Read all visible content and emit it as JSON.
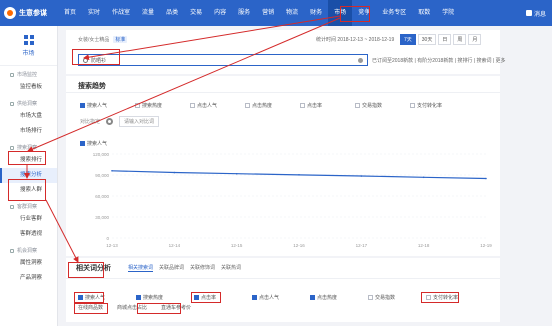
{
  "app": {
    "logo_text": "生意参谋"
  },
  "topnav": {
    "items": [
      "首页",
      "实时",
      "作战室",
      "流量",
      "品类",
      "交易",
      "内容",
      "服务",
      "营销",
      "物流",
      "财务",
      "市场",
      "竞争",
      "业务专区",
      "取数",
      "学院"
    ],
    "active_index": 11,
    "user": "消息"
  },
  "sidebar": {
    "title": "市场",
    "groups": [
      {
        "label": "市场监控",
        "items": [
          "监控看板"
        ]
      },
      {
        "label": "供给洞察",
        "items": [
          "市场大盘",
          "市场排行"
        ]
      },
      {
        "label": "搜索洞察",
        "items": [
          "搜索排行",
          "搜索分析",
          "搜索人群"
        ]
      },
      {
        "label": "客群洞察",
        "items": [
          "行业客群",
          "客群透视"
        ]
      },
      {
        "label": "机会洞察",
        "items": [
          "属性洞察",
          "产品洞察"
        ]
      }
    ],
    "selected": "搜索分析"
  },
  "header": {
    "breadcrumb_1": "女装/女士精品",
    "breadcrumb_tag": "标准",
    "date_range": "统计时间 2018-12-13 ~ 2018-12-19",
    "period_buttons": [
      "7天",
      "30天",
      "日",
      "周",
      "月"
    ],
    "search_value": "防晒衫",
    "links": "已订阅至2018新款 | 有阶分2018新款 | 搜排行 | 搜索词 | 更多"
  },
  "trend": {
    "title": "搜索趋势",
    "metrics": [
      {
        "label": "搜索人气",
        "checked": true
      },
      {
        "label": "搜索热度",
        "checked": false
      },
      {
        "label": "点击人气",
        "checked": false
      },
      {
        "label": "点击热度",
        "checked": false
      },
      {
        "label": "点击率",
        "checked": false
      },
      {
        "label": "交易指数",
        "checked": false
      },
      {
        "label": "支付转化率",
        "checked": false
      }
    ],
    "compare_label": "对比指定",
    "compare_placeholder": "请输入对比词",
    "legend": "搜索人气"
  },
  "chart_data": {
    "type": "line",
    "x": [
      "12-13",
      "12-14",
      "12-15",
      "12-16",
      "12-17",
      "12-18",
      "12-19"
    ],
    "series": [
      {
        "name": "搜索人气",
        "values": [
          96000,
          93500,
          91800,
          90200,
          88500,
          86700,
          85000
        ]
      }
    ],
    "yticks": [
      "120,000",
      "90,000",
      "60,000",
      "30,000",
      "0"
    ],
    "ylim": [
      0,
      120000
    ],
    "color": "#2b64c8"
  },
  "related": {
    "title": "相关词分析",
    "tabs": [
      "相关搜索词",
      "关联品牌词",
      "关联修饰词",
      "关联热词"
    ],
    "active_tab": 0,
    "metrics_row1": [
      {
        "label": "搜索人气",
        "checked": true
      },
      {
        "label": "搜索热度",
        "checked": true
      },
      {
        "label": "点击率",
        "checked": true
      },
      {
        "label": "点击人气",
        "checked": true
      },
      {
        "label": "点击热度",
        "checked": true
      },
      {
        "label": "交易指数",
        "checked": false
      },
      {
        "label": "支付转化率",
        "checked": false
      }
    ],
    "metrics_row2": [
      "在线商品数",
      "商城点击占比",
      "直通车参考价"
    ]
  },
  "colors": {
    "brand": "#2b64c8",
    "highlight": "#d42a2a"
  }
}
